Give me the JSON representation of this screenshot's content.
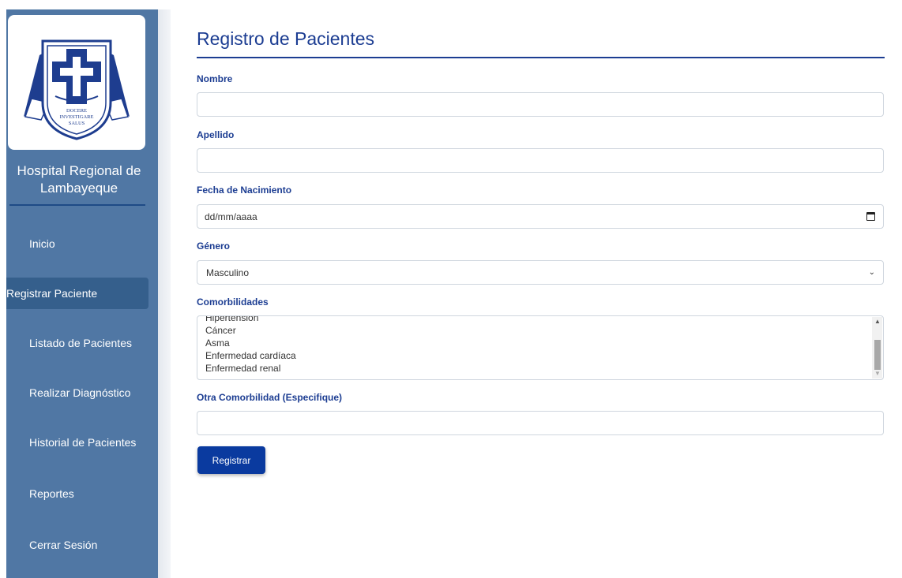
{
  "sidebar": {
    "logo": {
      "name": "hospital-shield-logo",
      "motto": [
        "DOCERE",
        "INVESTIGARE",
        "SALUS"
      ]
    },
    "hospital_name": "Hospital Regional de Lambayeque",
    "items": [
      {
        "label": "Inicio",
        "active": false
      },
      {
        "label": "Registrar Paciente",
        "active": true
      },
      {
        "label": "Listado de Pacientes",
        "active": false
      },
      {
        "label": "Realizar Diagnóstico",
        "active": false
      },
      {
        "label": "Historial de Pacientes",
        "active": false
      },
      {
        "label": "Reportes",
        "active": false
      },
      {
        "label": "Cerrar Sesión",
        "active": false
      }
    ]
  },
  "form": {
    "title": "Registro de Pacientes",
    "nombre_label": "Nombre",
    "nombre_value": "",
    "apellido_label": "Apellido",
    "apellido_value": "",
    "fecha_label": "Fecha de Nacimiento",
    "fecha_placeholder": "dd/mm/aaaa",
    "genero_label": "Género",
    "genero_value": "Masculino",
    "comorbilidades_label": "Comorbilidades",
    "comorbilidades_options": [
      "Hipertensión",
      "Cáncer",
      "Asma",
      "Enfermedad cardíaca",
      "Enfermedad renal"
    ],
    "otra_label": "Otra Comorbilidad (Especifique)",
    "otra_value": "",
    "submit_label": "Registrar"
  },
  "colors": {
    "sidebar_bg": "#5077a4",
    "sidebar_active": "#355f8c",
    "accent": "#1c3d92",
    "button": "#0a3a9f"
  }
}
